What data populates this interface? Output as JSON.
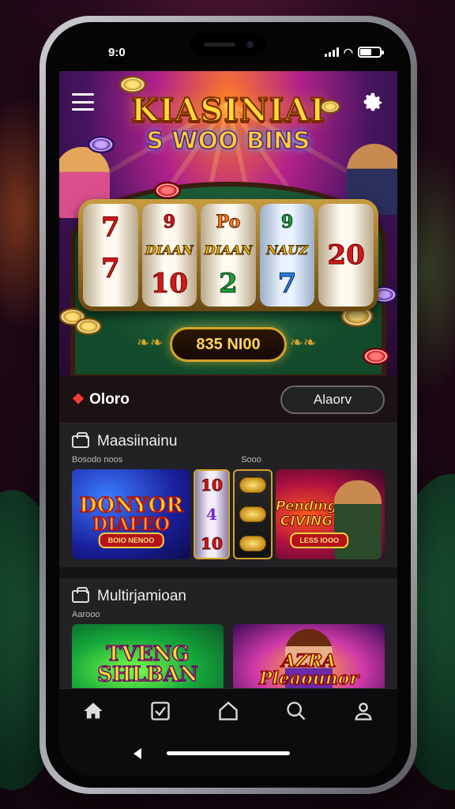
{
  "status_bar": {
    "time": "9:0"
  },
  "hero": {
    "title_line1": "KIASINIAI",
    "title_line2": "S WOO BINS",
    "reels": [
      [
        "7",
        "7",
        ""
      ],
      [
        "9",
        "DIAAN",
        "10"
      ],
      [
        "Po",
        "DIAAN",
        "2"
      ],
      [
        "9",
        "NAUZ",
        "7"
      ],
      [
        "",
        "20",
        ""
      ]
    ],
    "jackpot": "835 NI00"
  },
  "section_header": {
    "brand": "Oloro",
    "button": "Alaorv"
  },
  "panel1": {
    "title": "Maasiinainu",
    "sub_left": "Bosodo noos",
    "sub_right": "Sooo",
    "tile_bonus": {
      "line1": "DONYOR",
      "line2": "DIAFEO",
      "tag": "BOIO NENOO"
    },
    "tile_slot": [
      "10",
      "4",
      "10"
    ],
    "tile_pending": {
      "line1": "Pending",
      "line2": "CIVING",
      "tag": "LESS IOOO"
    }
  },
  "panel2": {
    "title": "Multirjamioan",
    "sub_left": "Aarooo",
    "tile_neon": {
      "line1": "TVENG",
      "line2": "SHLBAN"
    },
    "tile_lady": {
      "line1": "AZRA",
      "line2": "Pleaounor"
    }
  },
  "nav": [
    "home",
    "check",
    "house",
    "search",
    "profile"
  ],
  "colors": {
    "accent_gold": "#d4a32a",
    "brand_red": "#ff3b3b"
  }
}
